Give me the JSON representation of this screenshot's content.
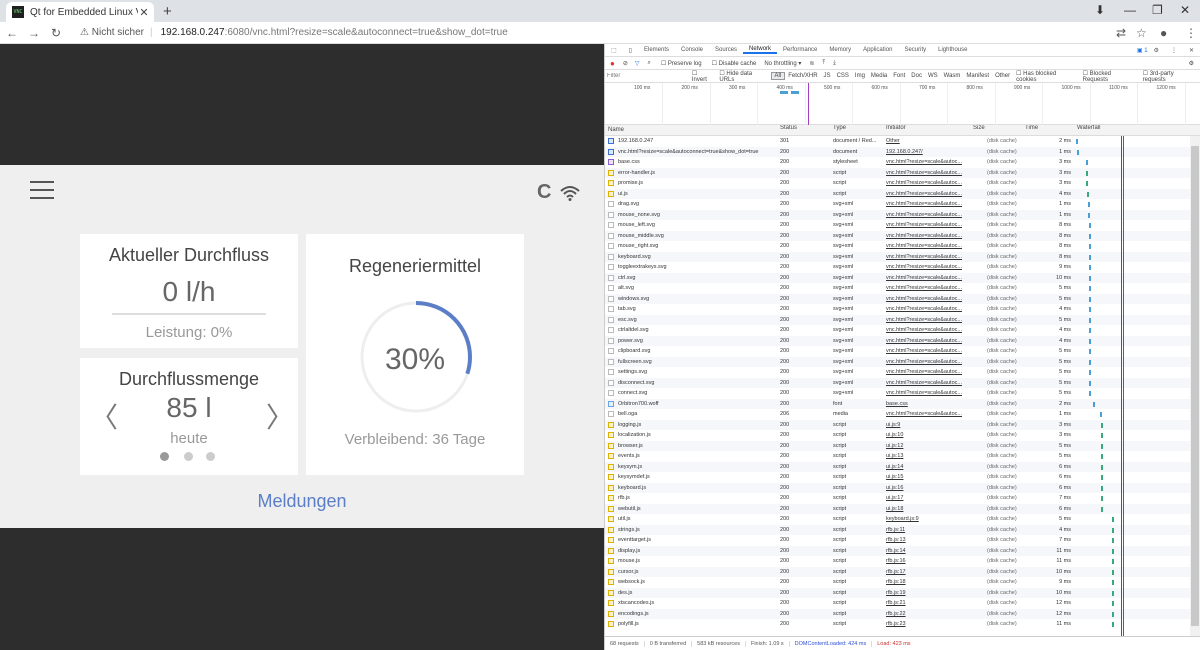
{
  "browser": {
    "tab_title": "Qt for Embedded Linux VNC Ser...",
    "favicon_text": "VNC",
    "tab_close": "✕",
    "new_tab": "+",
    "insecure_label": "Nicht sicher",
    "url_host": "192.168.0.247",
    "url_rest": ":6080/vnc.html?resize=scale&autoconnect=true&show_dot=true"
  },
  "app": {
    "flow_title": "Aktueller Durchfluss",
    "flow_value": "0 l/h",
    "flow_sub": "Leistung: 0%",
    "regen_title": "Regeneriermittel",
    "regen_percent": "30%",
    "regen_fraction": 0.3,
    "regen_sub": "Verbleibend: 36 Tage",
    "amount_title": "Durchflussmenge",
    "amount_value": "85 l",
    "amount_sub": "heute",
    "arrow_left": "〈",
    "arrow_right": "〉",
    "messages_link": "Meldungen",
    "c_icon": "C"
  },
  "devtools": {
    "tabs": [
      "Elements",
      "Console",
      "Sources",
      "Network",
      "Performance",
      "Memory",
      "Application",
      "Security",
      "Lighthouse"
    ],
    "active_tab": "Network",
    "badge": "1",
    "preserve_log": "Preserve log",
    "disable_cache": "Disable cache",
    "throttling": "No throttling",
    "filter_placeholder": "Filter",
    "invert": "Invert",
    "hide_data_urls": "Hide data URLs",
    "filter_types": [
      "All",
      "Fetch/XHR",
      "JS",
      "CSS",
      "Img",
      "Media",
      "Font",
      "Doc",
      "WS",
      "Wasm",
      "Manifest",
      "Other"
    ],
    "has_blocked_cookies": "Has blocked cookies",
    "blocked_requests": "Blocked Requests",
    "third_party": "3rd-party requests",
    "overview_ticks": [
      "100 ms",
      "200 ms",
      "300 ms",
      "400 ms",
      "500 ms",
      "600 ms",
      "700 ms",
      "800 ms",
      "900 ms",
      "1000 ms",
      "1100 ms",
      "1200 ms"
    ],
    "columns": [
      "Name",
      "Status",
      "Type",
      "Initiator",
      "Size",
      "Time",
      "Waterfall"
    ],
    "rows": [
      {
        "name": "192.168.0.247",
        "status": "301",
        "type": "document / Red...",
        "init": "Other",
        "size": "(disk cache)",
        "time": "2 ms",
        "icon": "doc",
        "wf": 0.02
      },
      {
        "name": "vnc.html?resize=scale&autoconnect=true&show_dot=true",
        "status": "200",
        "type": "document",
        "init": "192.168.0.247/",
        "size": "(disk cache)",
        "time": "1 ms",
        "icon": "doc",
        "wf": 0.03
      },
      {
        "name": "base.css",
        "status": "200",
        "type": "stylesheet",
        "init": "vnc.html?resize=scale&autoc...",
        "size": "(disk cache)",
        "time": "3 ms",
        "icon": "css",
        "wf": 0.1
      },
      {
        "name": "error-handler.js",
        "status": "200",
        "type": "script",
        "init": "vnc.html?resize=scale&autoc...",
        "size": "(disk cache)",
        "time": "3 ms",
        "icon": "js",
        "wf": 0.1
      },
      {
        "name": "promise.js",
        "status": "200",
        "type": "script",
        "init": "vnc.html?resize=scale&autoc...",
        "size": "(disk cache)",
        "time": "3 ms",
        "icon": "js",
        "wf": 0.1
      },
      {
        "name": "ui.js",
        "status": "200",
        "type": "script",
        "init": "vnc.html?resize=scale&autoc...",
        "size": "(disk cache)",
        "time": "4 ms",
        "icon": "js",
        "wf": 0.11
      },
      {
        "name": "drag.svg",
        "status": "200",
        "type": "svg+xml",
        "init": "vnc.html?resize=scale&autoc...",
        "size": "(disk cache)",
        "time": "1 ms",
        "icon": "img",
        "wf": 0.12
      },
      {
        "name": "mouse_none.svg",
        "status": "200",
        "type": "svg+xml",
        "init": "vnc.html?resize=scale&autoc...",
        "size": "(disk cache)",
        "time": "1 ms",
        "icon": "img",
        "wf": 0.12
      },
      {
        "name": "mouse_left.svg",
        "status": "200",
        "type": "svg+xml",
        "init": "vnc.html?resize=scale&autoc...",
        "size": "(disk cache)",
        "time": "8 ms",
        "icon": "img",
        "wf": 0.13
      },
      {
        "name": "mouse_middle.svg",
        "status": "200",
        "type": "svg+xml",
        "init": "vnc.html?resize=scale&autoc...",
        "size": "(disk cache)",
        "time": "8 ms",
        "icon": "img",
        "wf": 0.13
      },
      {
        "name": "mouse_right.svg",
        "status": "200",
        "type": "svg+xml",
        "init": "vnc.html?resize=scale&autoc...",
        "size": "(disk cache)",
        "time": "8 ms",
        "icon": "img",
        "wf": 0.13
      },
      {
        "name": "keyboard.svg",
        "status": "200",
        "type": "svg+xml",
        "init": "vnc.html?resize=scale&autoc...",
        "size": "(disk cache)",
        "time": "8 ms",
        "icon": "img",
        "wf": 0.13
      },
      {
        "name": "toggleextrakeys.svg",
        "status": "200",
        "type": "svg+xml",
        "init": "vnc.html?resize=scale&autoc...",
        "size": "(disk cache)",
        "time": "9 ms",
        "icon": "img",
        "wf": 0.13
      },
      {
        "name": "ctrl.svg",
        "status": "200",
        "type": "svg+xml",
        "init": "vnc.html?resize=scale&autoc...",
        "size": "(disk cache)",
        "time": "10 ms",
        "icon": "img",
        "wf": 0.13
      },
      {
        "name": "alt.svg",
        "status": "200",
        "type": "svg+xml",
        "init": "vnc.html?resize=scale&autoc...",
        "size": "(disk cache)",
        "time": "5 ms",
        "icon": "img",
        "wf": 0.13
      },
      {
        "name": "windows.svg",
        "status": "200",
        "type": "svg+xml",
        "init": "vnc.html?resize=scale&autoc...",
        "size": "(disk cache)",
        "time": "5 ms",
        "icon": "img",
        "wf": 0.13
      },
      {
        "name": "tab.svg",
        "status": "200",
        "type": "svg+xml",
        "init": "vnc.html?resize=scale&autoc...",
        "size": "(disk cache)",
        "time": "4 ms",
        "icon": "img",
        "wf": 0.13
      },
      {
        "name": "esc.svg",
        "status": "200",
        "type": "svg+xml",
        "init": "vnc.html?resize=scale&autoc...",
        "size": "(disk cache)",
        "time": "5 ms",
        "icon": "img",
        "wf": 0.13
      },
      {
        "name": "ctrlaltdel.svg",
        "status": "200",
        "type": "svg+xml",
        "init": "vnc.html?resize=scale&autoc...",
        "size": "(disk cache)",
        "time": "4 ms",
        "icon": "img",
        "wf": 0.13
      },
      {
        "name": "power.svg",
        "status": "200",
        "type": "svg+xml",
        "init": "vnc.html?resize=scale&autoc...",
        "size": "(disk cache)",
        "time": "4 ms",
        "icon": "img",
        "wf": 0.13
      },
      {
        "name": "clipboard.svg",
        "status": "200",
        "type": "svg+xml",
        "init": "vnc.html?resize=scale&autoc...",
        "size": "(disk cache)",
        "time": "5 ms",
        "icon": "img",
        "wf": 0.13
      },
      {
        "name": "fullscreen.svg",
        "status": "200",
        "type": "svg+xml",
        "init": "vnc.html?resize=scale&autoc...",
        "size": "(disk cache)",
        "time": "5 ms",
        "icon": "img",
        "wf": 0.13
      },
      {
        "name": "settings.svg",
        "status": "200",
        "type": "svg+xml",
        "init": "vnc.html?resize=scale&autoc...",
        "size": "(disk cache)",
        "time": "5 ms",
        "icon": "img",
        "wf": 0.13
      },
      {
        "name": "disconnect.svg",
        "status": "200",
        "type": "svg+xml",
        "init": "vnc.html?resize=scale&autoc...",
        "size": "(disk cache)",
        "time": "5 ms",
        "icon": "img",
        "wf": 0.13
      },
      {
        "name": "connect.svg",
        "status": "200",
        "type": "svg+xml",
        "init": "vnc.html?resize=scale&autoc...",
        "size": "(disk cache)",
        "time": "5 ms",
        "icon": "img",
        "wf": 0.13
      },
      {
        "name": "Orbitron700.woff",
        "status": "200",
        "type": "font",
        "init": "base.css",
        "size": "(disk cache)",
        "time": "2 ms",
        "icon": "font",
        "wf": 0.16
      },
      {
        "name": "bell.oga",
        "status": "206",
        "type": "media",
        "init": "vnc.html?resize=scale&autoc...",
        "size": "(disk cache)",
        "time": "1 ms",
        "icon": "img",
        "wf": 0.22
      },
      {
        "name": "logging.js",
        "status": "200",
        "type": "script",
        "init": "ui.js:9",
        "size": "(disk cache)",
        "time": "3 ms",
        "icon": "js",
        "wf": 0.23
      },
      {
        "name": "localization.js",
        "status": "200",
        "type": "script",
        "init": "ui.js:10",
        "size": "(disk cache)",
        "time": "3 ms",
        "icon": "js",
        "wf": 0.23
      },
      {
        "name": "browser.js",
        "status": "200",
        "type": "script",
        "init": "ui.js:12",
        "size": "(disk cache)",
        "time": "5 ms",
        "icon": "js",
        "wf": 0.23
      },
      {
        "name": "events.js",
        "status": "200",
        "type": "script",
        "init": "ui.js:13",
        "size": "(disk cache)",
        "time": "5 ms",
        "icon": "js",
        "wf": 0.23
      },
      {
        "name": "keysym.js",
        "status": "200",
        "type": "script",
        "init": "ui.js:14",
        "size": "(disk cache)",
        "time": "6 ms",
        "icon": "js",
        "wf": 0.23
      },
      {
        "name": "keysymdef.js",
        "status": "200",
        "type": "script",
        "init": "ui.js:15",
        "size": "(disk cache)",
        "time": "6 ms",
        "icon": "js",
        "wf": 0.23
      },
      {
        "name": "keyboard.js",
        "status": "200",
        "type": "script",
        "init": "ui.js:16",
        "size": "(disk cache)",
        "time": "6 ms",
        "icon": "js",
        "wf": 0.23
      },
      {
        "name": "rfb.js",
        "status": "200",
        "type": "script",
        "init": "ui.js:17",
        "size": "(disk cache)",
        "time": "7 ms",
        "icon": "js",
        "wf": 0.23
      },
      {
        "name": "webutil.js",
        "status": "200",
        "type": "script",
        "init": "ui.js:18",
        "size": "(disk cache)",
        "time": "6 ms",
        "icon": "js",
        "wf": 0.23
      },
      {
        "name": "util.js",
        "status": "200",
        "type": "script",
        "init": "keyboard.js:9",
        "size": "(disk cache)",
        "time": "5 ms",
        "icon": "js",
        "wf": 0.33
      },
      {
        "name": "strings.js",
        "status": "200",
        "type": "script",
        "init": "rfb.js:11",
        "size": "(disk cache)",
        "time": "4 ms",
        "icon": "js",
        "wf": 0.33
      },
      {
        "name": "eventtarget.js",
        "status": "200",
        "type": "script",
        "init": "rfb.js:13",
        "size": "(disk cache)",
        "time": "7 ms",
        "icon": "js",
        "wf": 0.33
      },
      {
        "name": "display.js",
        "status": "200",
        "type": "script",
        "init": "rfb.js:14",
        "size": "(disk cache)",
        "time": "11 ms",
        "icon": "js",
        "wf": 0.33
      },
      {
        "name": "mouse.js",
        "status": "200",
        "type": "script",
        "init": "rfb.js:16",
        "size": "(disk cache)",
        "time": "11 ms",
        "icon": "js",
        "wf": 0.33
      },
      {
        "name": "cursor.js",
        "status": "200",
        "type": "script",
        "init": "rfb.js:17",
        "size": "(disk cache)",
        "time": "10 ms",
        "icon": "js",
        "wf": 0.33
      },
      {
        "name": "websock.js",
        "status": "200",
        "type": "script",
        "init": "rfb.js:18",
        "size": "(disk cache)",
        "time": "9 ms",
        "icon": "js",
        "wf": 0.33
      },
      {
        "name": "des.js",
        "status": "200",
        "type": "script",
        "init": "rfb.js:19",
        "size": "(disk cache)",
        "time": "10 ms",
        "icon": "js",
        "wf": 0.33
      },
      {
        "name": "xtscancodes.js",
        "status": "200",
        "type": "script",
        "init": "rfb.js:21",
        "size": "(disk cache)",
        "time": "12 ms",
        "icon": "js",
        "wf": 0.33
      },
      {
        "name": "encodings.js",
        "status": "200",
        "type": "script",
        "init": "rfb.js:22",
        "size": "(disk cache)",
        "time": "12 ms",
        "icon": "js",
        "wf": 0.33
      },
      {
        "name": "polyfill.js",
        "status": "200",
        "type": "script",
        "init": "rfb.js:23",
        "size": "(disk cache)",
        "time": "11 ms",
        "icon": "js",
        "wf": 0.33
      }
    ],
    "status": {
      "requests": "68 requests",
      "transferred": "0 B transferred",
      "resources": "583 kB resources",
      "finish": "Finish: 1.09 s",
      "dcl": "DOMContentLoaded: 424 ms",
      "load": "Load: 423 ms"
    }
  },
  "colors": {
    "accent": "#5b7ec6",
    "dcl_line": "#3050d8",
    "load_line": "#d03030"
  }
}
